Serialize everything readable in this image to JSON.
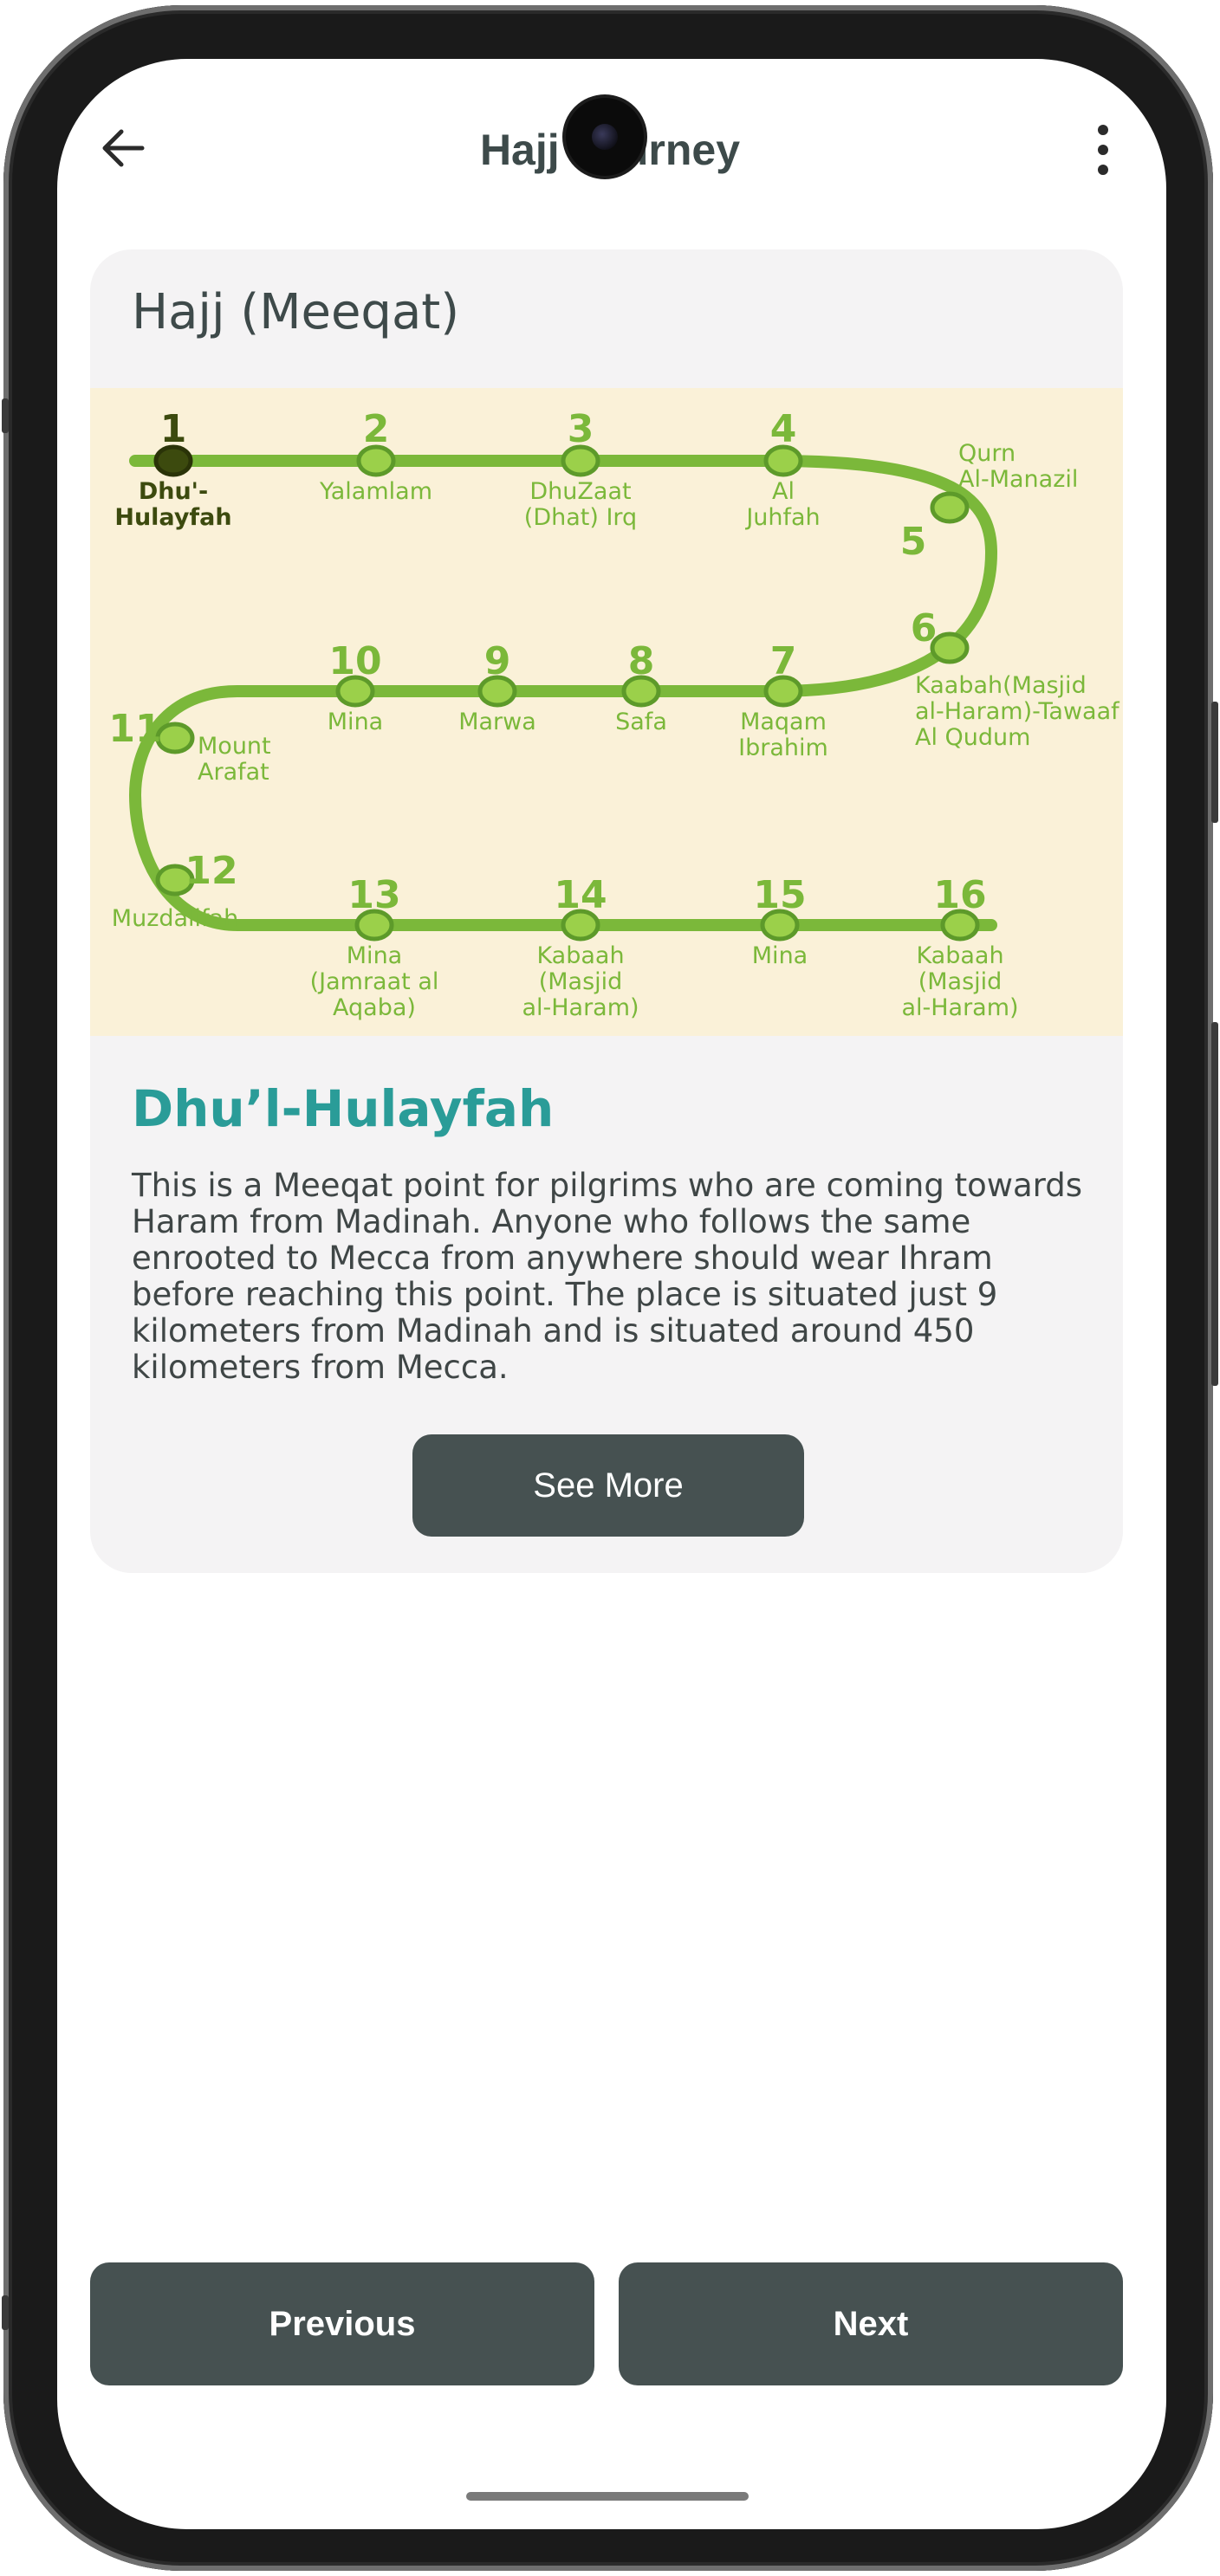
{
  "app_bar": {
    "title": "Hajj Journey",
    "back_icon": "arrow-left-icon",
    "menu_icon": "more-vertical-icon"
  },
  "card": {
    "heading": "Hajj (Meeqat)",
    "journey_map": {
      "active_stop": 1,
      "colors": {
        "path": "#7bb83a",
        "path_dark": "#5d9a2a",
        "active": "#3c4a0e",
        "background": "#faf1d8"
      },
      "stops": [
        {
          "number": "1",
          "label_lines": [
            "Dhu'-",
            "Hulayfah"
          ]
        },
        {
          "number": "2",
          "label_lines": [
            "Yalamlam"
          ]
        },
        {
          "number": "3",
          "label_lines": [
            "DhuZaat",
            "(Dhat) Irq"
          ]
        },
        {
          "number": "4",
          "label_lines": [
            "Al",
            "Juhfah"
          ]
        },
        {
          "number": "5",
          "label_lines": [
            "Qurn",
            "Al-Manazil"
          ]
        },
        {
          "number": "6",
          "label_lines": [
            "Kaabah(Masjid",
            "al-Haram)-Tawaaf",
            "Al Qudum"
          ]
        },
        {
          "number": "7",
          "label_lines": [
            "Maqam",
            "Ibrahim"
          ]
        },
        {
          "number": "8",
          "label_lines": [
            "Safa"
          ]
        },
        {
          "number": "9",
          "label_lines": [
            "Marwa"
          ]
        },
        {
          "number": "10",
          "label_lines": [
            "Mina"
          ]
        },
        {
          "number": "11",
          "label_lines": [
            "Mount",
            "Arafat"
          ]
        },
        {
          "number": "12",
          "label_lines": [
            "Muzdalifah"
          ]
        },
        {
          "number": "13",
          "label_lines": [
            "Mina",
            "(Jamraat al",
            "Aqaba)"
          ]
        },
        {
          "number": "14",
          "label_lines": [
            "Kabaah",
            "(Masjid",
            "al-Haram)"
          ]
        },
        {
          "number": "15",
          "label_lines": [
            "Mina"
          ]
        },
        {
          "number": "16",
          "label_lines": [
            "Kabaah",
            "(Masjid",
            "al-Haram)"
          ]
        }
      ]
    },
    "stop_title": "Dhu’l-Hulayfah",
    "description": "This is a Meeqat point for pilgrims who are coming towards Haram from Madinah. Anyone who follows the same enrooted to Mecca from anywhere should wear Ihram before reaching this point. The place is situated just 9 kilometers from Madinah and is situated around 450 kilometers from Mecca.",
    "see_more_label": "See More"
  },
  "footer": {
    "previous_label": "Previous",
    "next_label": "Next"
  }
}
